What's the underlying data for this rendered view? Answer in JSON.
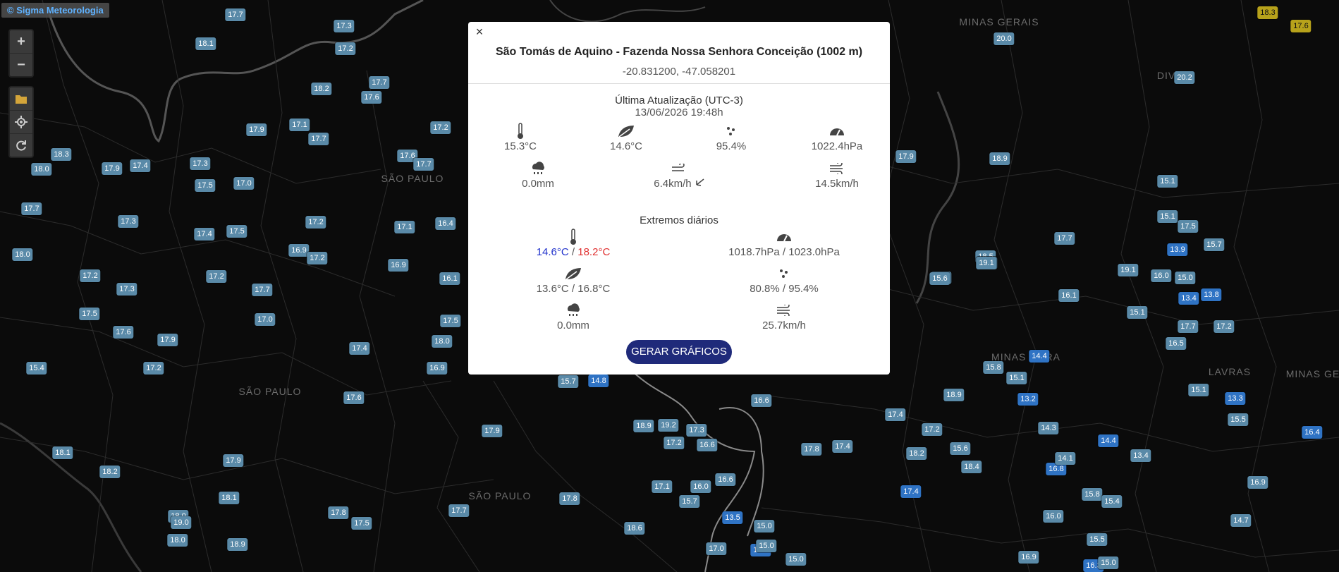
{
  "attribution": "© Sigma Meteorologia",
  "map_controls": {
    "zoom_in": "+",
    "zoom_out": "−"
  },
  "places": [
    {
      "id": "minas-gerais-1",
      "label": "MINAS GERAIS"
    },
    {
      "id": "sao-paulo-1",
      "label": "SÃO PAULO"
    },
    {
      "id": "sao-paulo-2",
      "label": "SÃO PAULO"
    },
    {
      "id": "sao-paulo-3",
      "label": "SÃO PAULO"
    },
    {
      "id": "minas-gerais-2",
      "label": "MINAS GERA"
    },
    {
      "id": "minas-gerais-3",
      "label": "MINAS GE"
    },
    {
      "id": "lavras",
      "label": "LAVRAS"
    },
    {
      "id": "divinopolis",
      "label": "DIV"
    }
  ],
  "markers": [
    "17.7",
    "18.1",
    "17.3",
    "17.2",
    "18.2",
    "17.7",
    "17.6",
    "17.9",
    "17.1",
    "17.7",
    "17.2",
    "18.3",
    "18.0",
    "17.9",
    "17.4",
    "17.3",
    "17.5",
    "17.0",
    "17.6",
    "17.7",
    "17.7",
    "17.3",
    "17.4",
    "17.5",
    "17.2",
    "17.1",
    "16.4",
    "18.0",
    "16.9",
    "17.2",
    "16.9",
    "16.1",
    "17.2",
    "17.3",
    "17.2",
    "17.7",
    "17.5",
    "17.6",
    "17.9",
    "17.0",
    "17.4",
    "17.5",
    "18.0",
    "16.9",
    "17.6",
    "17.2",
    "15.4",
    "15.7",
    "14.8",
    "16.6",
    "17.9",
    "18.9",
    "19.2",
    "17.3",
    "17.2",
    "16.6",
    "17.8",
    "17.4",
    "17.9",
    "18.1",
    "18.2",
    "18.1",
    "17.8",
    "17.7",
    "18.0",
    "17.5",
    "17.8",
    "18.6",
    "19.0",
    "18.0",
    "18.9",
    "17.1",
    "16.0",
    "16.6",
    "15.7",
    "13.5",
    "15.0",
    "17.0",
    "14.5",
    "15.0",
    "18.9",
    "17.9",
    "18.5",
    "19.1",
    "17.7",
    "15.1",
    "15.1",
    "19.1",
    "17.9",
    "16.1",
    "17.5",
    "15.7",
    "13.9",
    "16.0",
    "15.0",
    "13.4",
    "13.8",
    "15.6",
    "19.1",
    "16.1",
    "15.1",
    "17.7",
    "17.2",
    "14.4",
    "15.8",
    "15.1",
    "18.9",
    "13.2",
    "15.1",
    "13.3",
    "15.5",
    "17.4",
    "17.2",
    "15.6",
    "18.2",
    "18.4",
    "14.3",
    "14.4",
    "16.8",
    "14.1",
    "13.4",
    "16.4",
    "17.4",
    "15.8",
    "15.4",
    "16.9",
    "16.0",
    "14.7",
    "15.5",
    "16.3",
    "15.0",
    "16.9",
    "18.3",
    "17.6",
    "20.0",
    "20.2",
    "16.5",
    "15.0"
  ],
  "popup": {
    "close_label": "×",
    "station_name": "São Tomás de Aquino - Fazenda Nossa Senhora Conceição (1002 m)",
    "coordinates": "-20.831200, -47.058201",
    "update_title": "Última Atualização (UTC-3)",
    "update_time": "13/06/2026 19:48h",
    "current": {
      "temperature": "15.3°C",
      "dew_point": "14.6°C",
      "humidity": "95.4%",
      "pressure": "1022.4hPa",
      "rain": "0.0mm",
      "wind": "6.4km/h",
      "gust": "14.5km/h"
    },
    "extremes_title": "Extremos diários",
    "extremes": {
      "temp_min": "14.6°C",
      "temp_sep": " / ",
      "temp_max": "18.2°C",
      "pressure": "1018.7hPa / 1023.0hPa",
      "dew_point": "13.6°C / 16.8°C",
      "humidity": "80.8% / 95.4%",
      "rain": "0.0mm",
      "gust": "25.7km/h"
    },
    "button_label": "GERAR GRÁFICOS"
  },
  "colors": {
    "marker_mid": "#5a8aa8",
    "marker_cold": "#2f73c4",
    "marker_warm": "#b7a21b",
    "button": "#1f2a7a",
    "min_temp": "#2233cc",
    "max_temp": "#e03030"
  }
}
